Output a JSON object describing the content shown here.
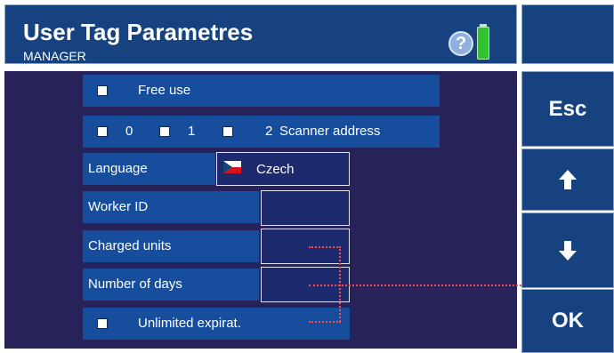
{
  "header": {
    "title": "User Tag Parametres",
    "subtitle": "MANAGER",
    "help_glyph": "?",
    "help_icon": "question-circle-icon",
    "status_icon": "battery-icon"
  },
  "sidebar": {
    "esc_label": "Esc",
    "up_icon": "arrow-up-icon",
    "up_glyph": "🡅",
    "down_icon": "arrow-down-icon",
    "down_glyph": "🡇",
    "ok_label": "OK"
  },
  "form": {
    "free_use": {
      "label": "Free use",
      "checked": false
    },
    "scanner": {
      "options": [
        {
          "label": "0",
          "checked": false
        },
        {
          "label": "1",
          "checked": false
        },
        {
          "label": "2",
          "checked": false
        }
      ],
      "label": "Scanner address"
    },
    "language": {
      "label": "Language",
      "value": "Czech",
      "flag_icon": "czech-flag-icon"
    },
    "worker_id": {
      "label": "Worker ID",
      "value": ""
    },
    "charged_units": {
      "label": "Charged units",
      "value": ""
    },
    "number_of_days": {
      "label": "Number of days",
      "value": ""
    },
    "unlimited": {
      "label": "Unlimited expirat.",
      "checked": false
    }
  },
  "colors": {
    "panel_background": "#27235a",
    "row_background": "#164e9d",
    "header_background": "#16437f",
    "annotation_line": "#ff4a4a"
  }
}
